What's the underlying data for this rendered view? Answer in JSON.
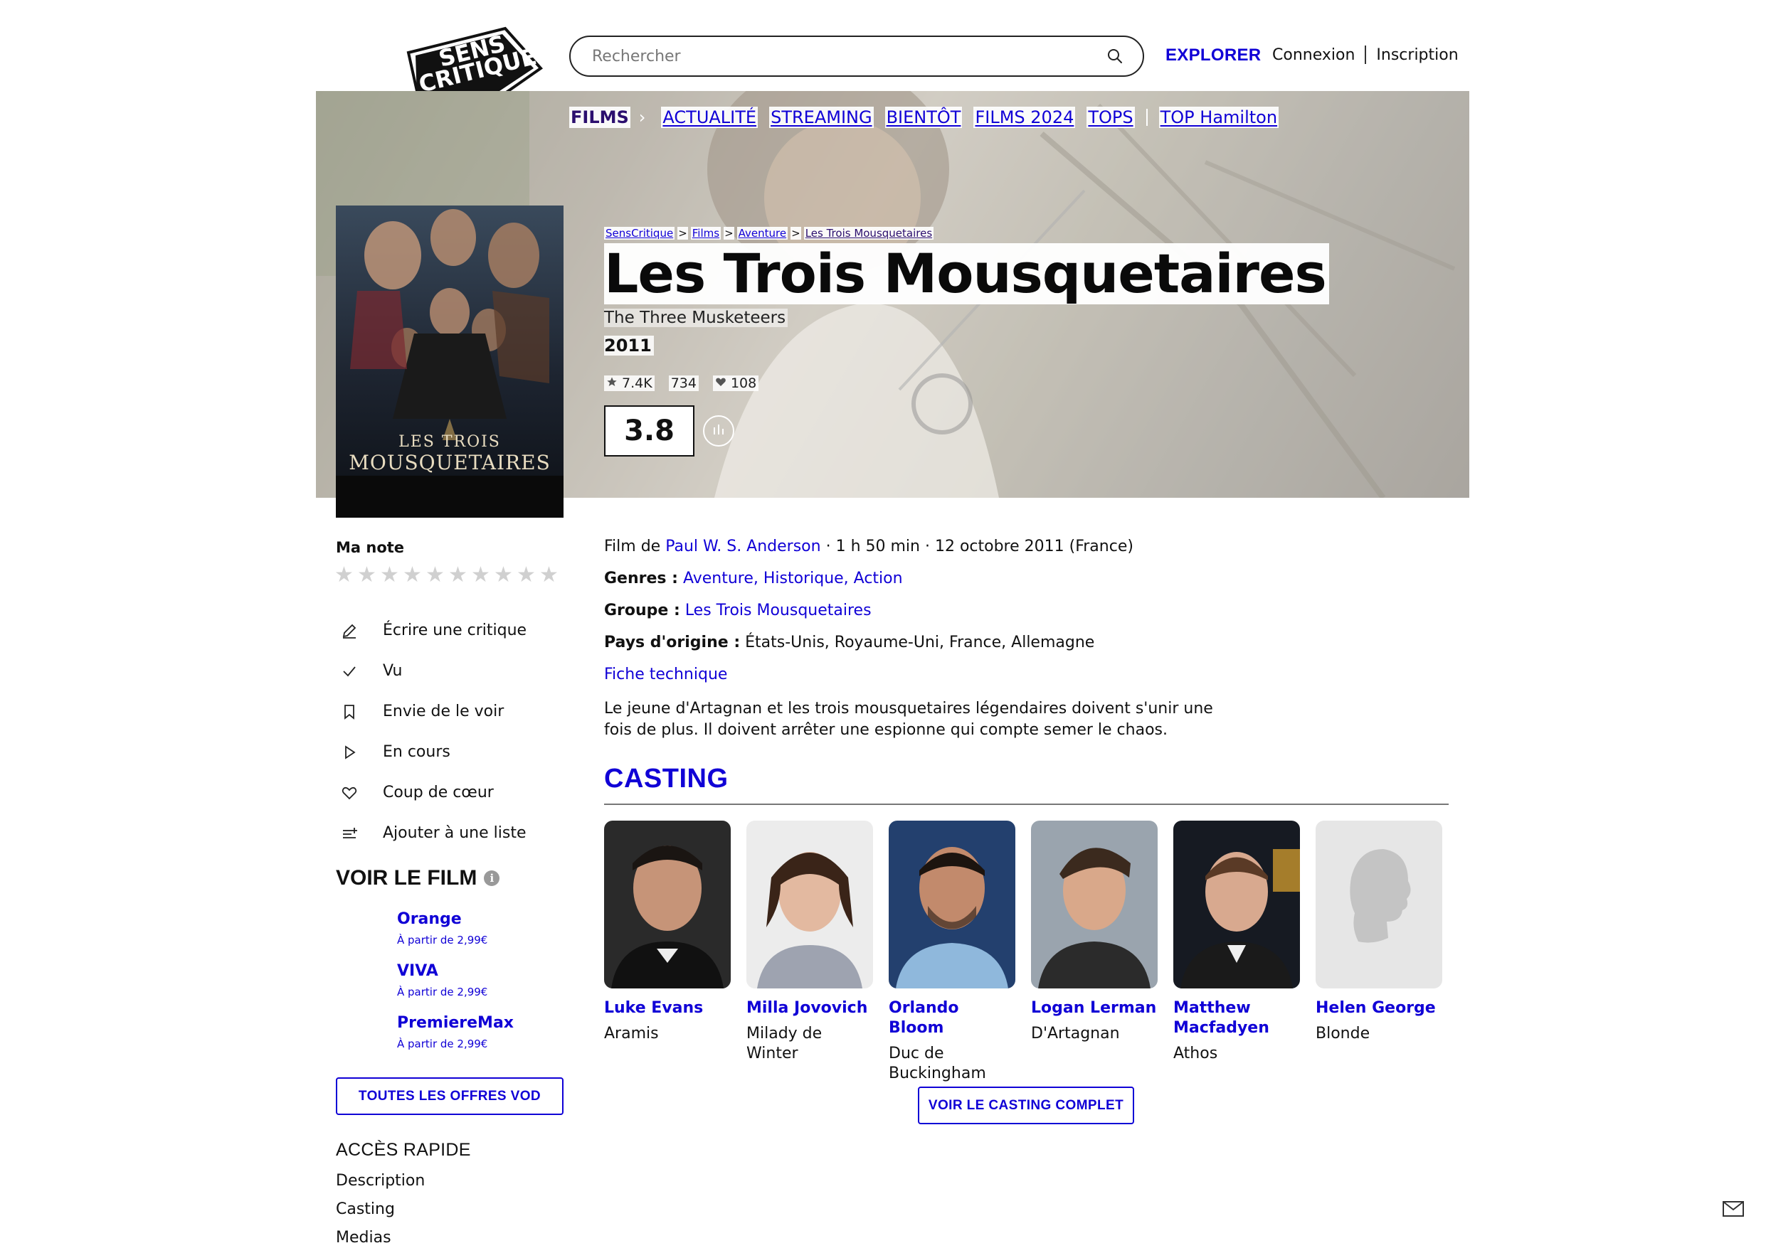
{
  "brand": {
    "logo_line1": "SENS",
    "logo_line2": "CRITIQUE",
    "accent": "#1000d6"
  },
  "header": {
    "search_placeholder": "Rechercher",
    "explore": "EXPLORER",
    "login": "Connexion",
    "signup": "Inscription"
  },
  "catnav": {
    "items": [
      "FILMS",
      "ACTUALITÉ",
      "STREAMING",
      "BIENTÔT",
      "FILMS 2024",
      "TOPS",
      "TOP Hamilton"
    ]
  },
  "breadcrumb": [
    "SensCritique",
    "Films",
    "Aventure",
    "Les Trois Mousquetaires"
  ],
  "movie": {
    "title": "Les Trois Mousquetaires",
    "original_title": "The Three Musketeers",
    "year": "2011",
    "ratings_count": "7.4K",
    "wishes_count": "734",
    "likes_count": "108",
    "average": "3.8",
    "poster_title_1": "LES TROIS",
    "poster_title_2": "MOUSQUETAIRES"
  },
  "my_rating": {
    "label": "Ma note",
    "max": 10,
    "value": 0
  },
  "actions": [
    {
      "label": "Écrire une critique",
      "icon": "pencil-icon"
    },
    {
      "label": "Vu",
      "icon": "check-icon"
    },
    {
      "label": "Envie de le voir",
      "icon": "bookmark-icon"
    },
    {
      "label": "En cours",
      "icon": "play-icon"
    },
    {
      "label": "Coup de cœur",
      "icon": "heart-icon"
    },
    {
      "label": "Ajouter à une liste",
      "icon": "list-add-icon"
    }
  ],
  "watch": {
    "title": "VOIR LE FILM",
    "offers": [
      {
        "name": "Orange",
        "price": "À partir de 2,99€"
      },
      {
        "name": "VIVA",
        "price": "À partir de 2,99€"
      },
      {
        "name": "PremiereMax",
        "price": "À partir de 2,99€"
      }
    ],
    "all_offers": "TOUTES LES OFFRES VOD"
  },
  "quick_access": {
    "title": "ACCÈS RAPIDE",
    "items": [
      "Description",
      "Casting",
      "Medias"
    ]
  },
  "details": {
    "film_by_prefix": "Film de",
    "director": "Paul W. S. Anderson",
    "duration_release": " · 1 h 50 min · 12 octobre 2011 (France)",
    "genres_label": "Genres :",
    "genres": "Aventure, Historique, Action",
    "group_label": "Groupe :",
    "group": "Les Trois Mousquetaires",
    "country_label": "Pays d'origine :",
    "countries": "États-Unis, Royaume-Uni, France, Allemagne",
    "tech_sheet": "Fiche technique",
    "synopsis": "Le jeune d'Artagnan et les trois mousquetaires légendaires doivent s'unir une fois de plus. Il doivent arrêter une espionne qui compte semer le chaos."
  },
  "casting": {
    "title": "CASTING",
    "actors": [
      {
        "name": "Luke Evans",
        "role": "Aramis"
      },
      {
        "name": "Milla Jovovich",
        "role": "Milady de Winter"
      },
      {
        "name": "Orlando Bloom",
        "role": "Duc de Buckingham"
      },
      {
        "name": "Logan Lerman",
        "role": "D'Artagnan"
      },
      {
        "name": "Matthew Macfadyen",
        "role": "Athos"
      },
      {
        "name": "Helen George",
        "role": "Blonde"
      }
    ],
    "full_cast": "VOIR LE CASTING COMPLET"
  }
}
